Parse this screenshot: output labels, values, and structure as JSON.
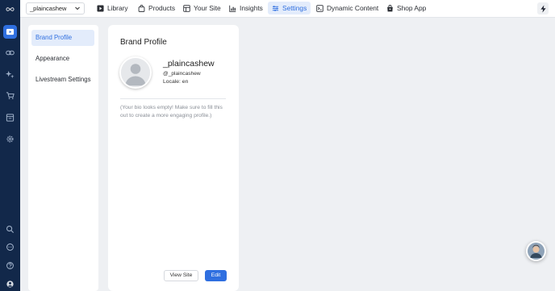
{
  "topbar": {
    "account": "_plaincashew",
    "nav": [
      {
        "label": "Library",
        "icon": "play-square-icon"
      },
      {
        "label": "Products",
        "icon": "bag-icon"
      },
      {
        "label": "Your Site",
        "icon": "layout-icon"
      },
      {
        "label": "Insights",
        "icon": "chart-icon"
      },
      {
        "label": "Settings",
        "icon": "sliders-icon",
        "active": true
      },
      {
        "label": "Dynamic Content",
        "icon": "terminal-icon"
      },
      {
        "label": "Shop App",
        "icon": "shop-bag-icon"
      }
    ]
  },
  "sidebar": {
    "items": [
      {
        "label": "Brand Profile",
        "active": true
      },
      {
        "label": "Appearance"
      },
      {
        "label": "Livestream Settings"
      }
    ]
  },
  "profile": {
    "title": "Brand Profile",
    "username": "_plaincashew",
    "handle": "@_plaincashew",
    "locale": "Locale: en",
    "bio": "(Your bio looks empty! Make sure to fill this out to create a more engaging profile.)",
    "view_label": "View Site",
    "edit_label": "Edit"
  },
  "colors": {
    "rail": "#12284a",
    "accent": "#2f6fe0",
    "active_bg": "#e3ecfb"
  }
}
